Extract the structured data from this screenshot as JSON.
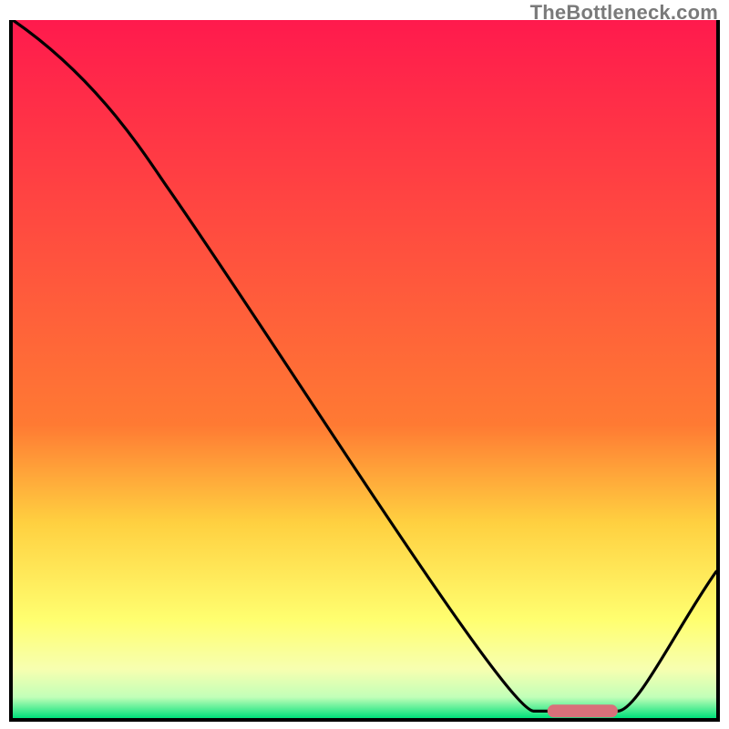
{
  "watermark": "TheBottleneck.com",
  "colors": {
    "gradient_top": "#ff1a4d",
    "gradient_mid1": "#ff7a33",
    "gradient_mid2": "#ffd040",
    "gradient_mid3": "#ffff70",
    "gradient_mid4": "#f7ffb0",
    "gradient_bottom": "#00e07a",
    "curve": "#000000",
    "marker": "#d9707a",
    "axis": "#000000"
  },
  "chart_data": {
    "type": "line",
    "title": "",
    "xlabel": "",
    "ylabel": "",
    "xlim": [
      0,
      100
    ],
    "ylim": [
      0,
      100
    ],
    "x": [
      0,
      22,
      74,
      86,
      100
    ],
    "values": [
      100,
      76,
      1,
      1,
      21
    ],
    "marker_range_x": [
      76,
      86
    ],
    "gradient_bands_y_pct": [
      0,
      58,
      72,
      86,
      93,
      97,
      100
    ],
    "legend": false,
    "grid": false
  }
}
